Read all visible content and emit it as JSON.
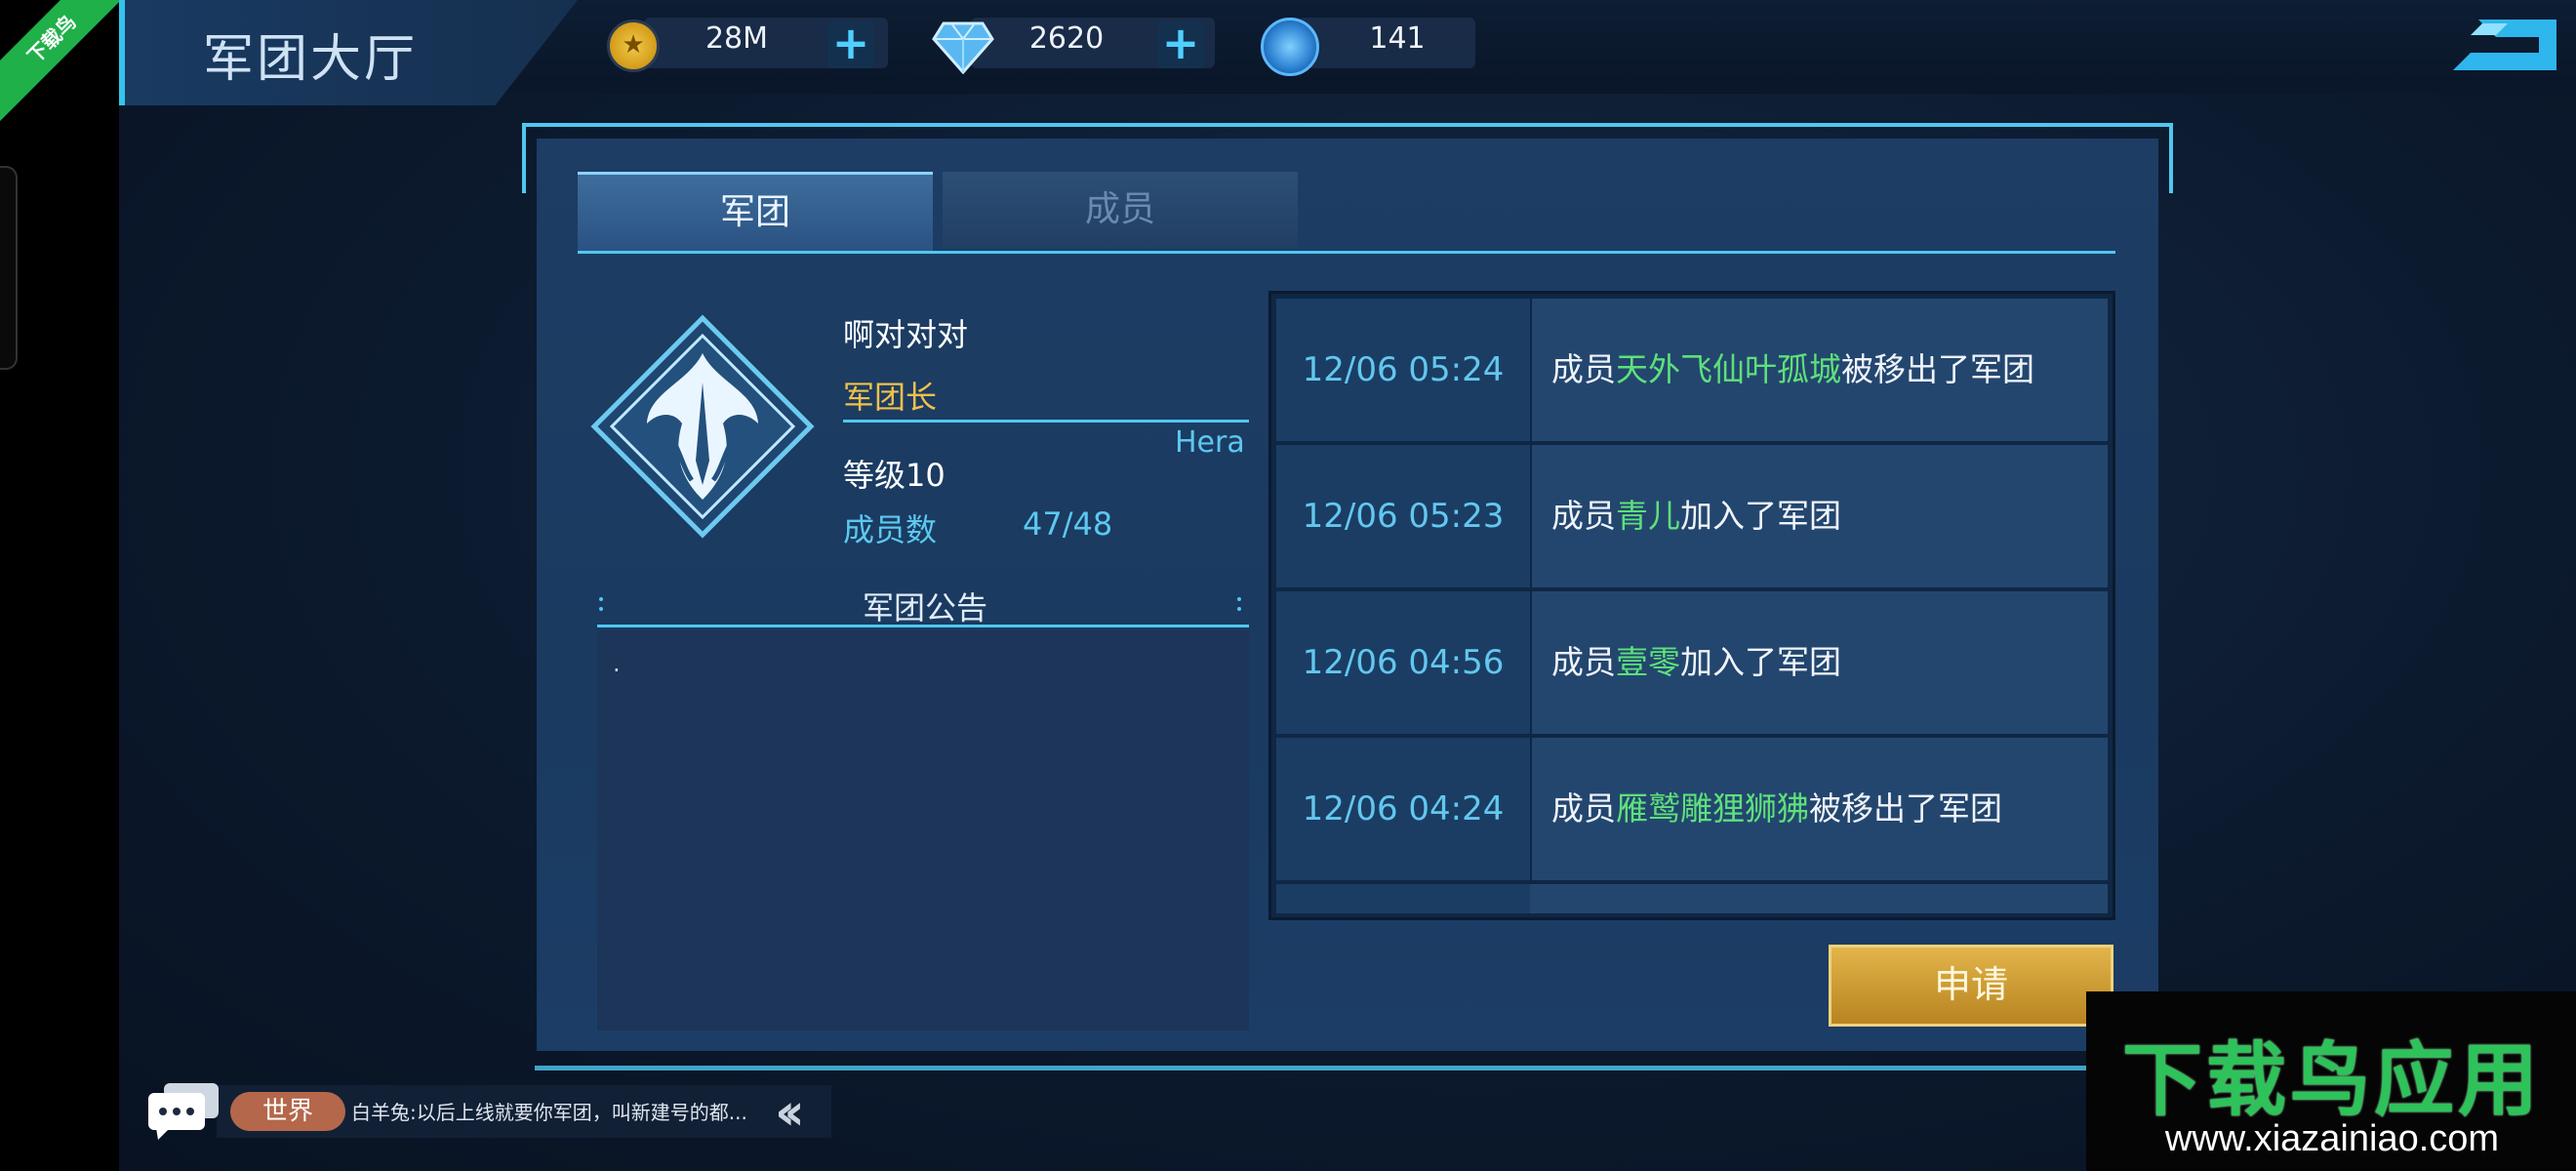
{
  "app": {
    "title": "军团大厅"
  },
  "currencies": [
    {
      "name": "gold",
      "value": "28M"
    },
    {
      "name": "diamond",
      "value": "2620"
    },
    {
      "name": "energy",
      "value": "141"
    }
  ],
  "tabs": [
    {
      "label": "军团",
      "active": true
    },
    {
      "label": "成员",
      "active": false
    }
  ],
  "guild": {
    "name": "啊对对对",
    "role": "军团长",
    "leader": "Hera",
    "level": "等级10",
    "member_count_label": "成员数",
    "member_count": "47/48",
    "notice_title": "军团公告",
    "notice_text": "."
  },
  "log": [
    {
      "time": "12/06 05:24",
      "prefix": "成员",
      "name": "天外飞仙叶孤城",
      "suffix": "被移出了军团"
    },
    {
      "time": "12/06 05:23",
      "prefix": "成员",
      "name": "青儿",
      "suffix": "加入了军团"
    },
    {
      "time": "12/06 04:56",
      "prefix": "成员",
      "name": "壹零",
      "suffix": "加入了军团"
    },
    {
      "time": "12/06 04:24",
      "prefix": "成员",
      "name": "雁鹫雕狸狮狒",
      "suffix": "被移出了军团"
    }
  ],
  "apply_label": "申请",
  "chat": {
    "channel": "世界",
    "message": "白羊兔:以后上线就要你军团，叫新建号的都..."
  },
  "overlay": {
    "corner_badge": "下载鸟",
    "watermark_title": "下载鸟应用",
    "watermark_url": "www.xiazainiao.com"
  },
  "colors": {
    "accent": "#4fc8f0",
    "highlight_name": "#5ee07a",
    "role": "#f1c14a",
    "apply_button": "#d2a23a"
  },
  "icons": [
    "coin-icon",
    "diamond-icon",
    "energy-icon",
    "plus-icon",
    "exit-icon",
    "guild-emblem",
    "chat-icon",
    "collapse-icon"
  ]
}
